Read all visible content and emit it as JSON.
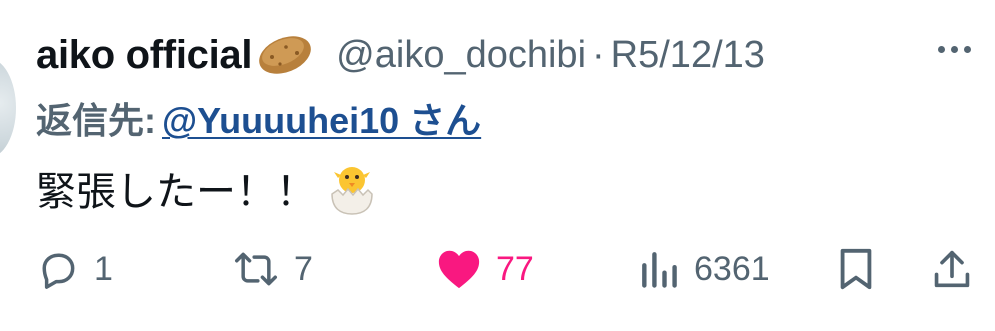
{
  "tweet": {
    "display_name": "aiko official",
    "name_emoji": "potato",
    "handle": "@aiko_dochibi",
    "separator": "·",
    "date": "R5/12/13",
    "reply_prefix": "返信先:",
    "reply_to": "@Yuuuuhei10 さん",
    "text": "緊張したー！！",
    "text_emoji": "hatching-chick"
  },
  "actions": {
    "replies": "1",
    "retweets": "7",
    "likes": "77",
    "views": "6361"
  },
  "colors": {
    "text_primary": "#0f1419",
    "text_secondary": "#536471",
    "link": "#1d4f91",
    "like": "#f91880"
  }
}
